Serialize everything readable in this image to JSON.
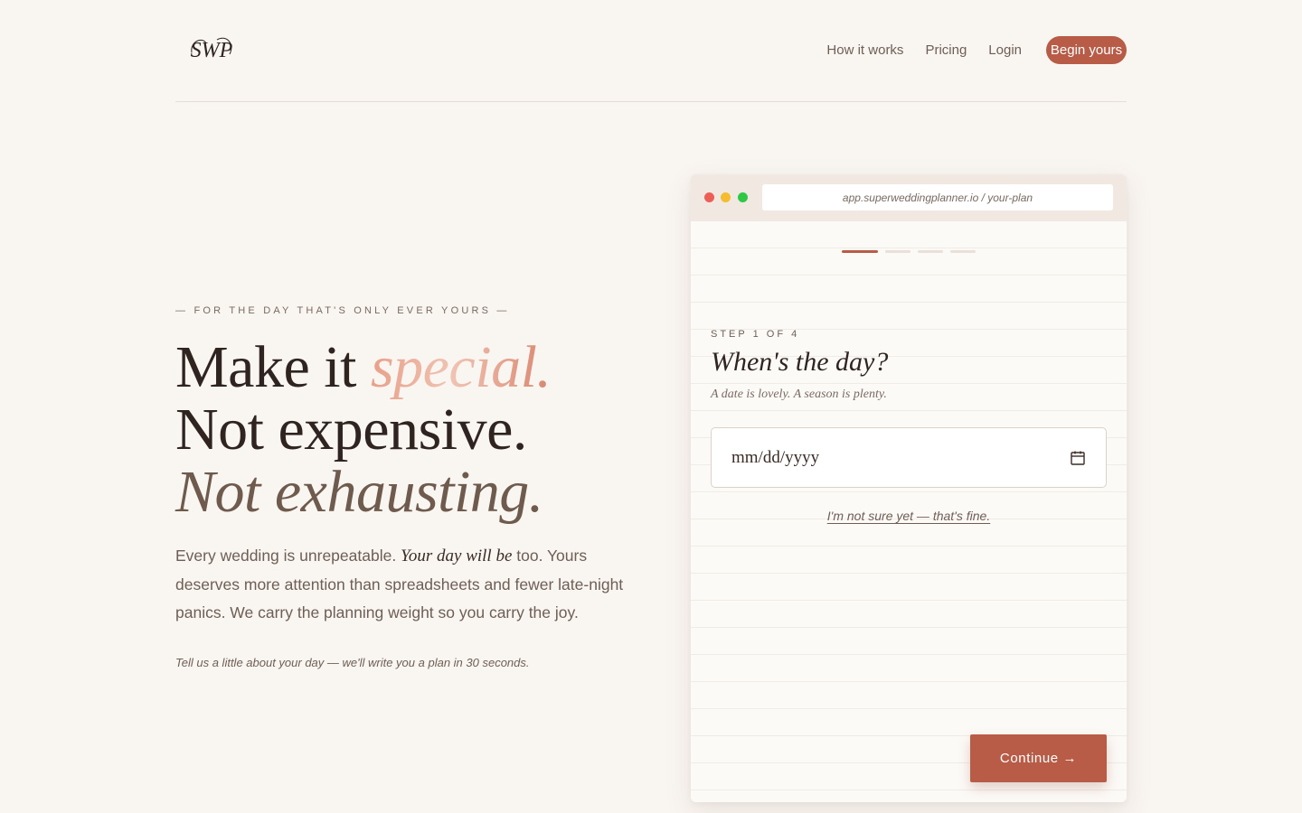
{
  "header": {
    "logo_alt": "SWP",
    "nav": [
      {
        "label": "How it works"
      },
      {
        "label": "Pricing"
      },
      {
        "label": "Login"
      }
    ],
    "cta_label": "Begin yours"
  },
  "hero": {
    "eyebrow": "— FOR THE DAY THAT'S ONLY EVER YOURS —",
    "headline_line1_prefix": "Make it ",
    "headline_line1_accent": "special.",
    "headline_line2": "Not expensive.",
    "headline_line3": "Not exhausting.",
    "lede_part1": "Every wedding is unrepeatable. ",
    "lede_emphasis": "Your day will be",
    "lede_part2": " too. Yours deserves more attention than spreadsheets and fewer late-night panics. We carry the planning weight so you carry the joy.",
    "footnote": "Tell us a little about your day — we'll write you a plan in 30 seconds."
  },
  "browser": {
    "url": "app.superweddingplanner.io / your-plan",
    "progress_steps": 4,
    "progress_active": 1,
    "step_label": "STEP 1 OF 4",
    "step_title": "When's the day?",
    "step_subtitle": "A date is lovely. A season is plenty.",
    "date_placeholder": "mm/dd/yyyy",
    "not_sure_link": "I'm not sure yet — that's fine.",
    "continue_label": "Continue →"
  },
  "colors": {
    "accent": "#b85c48",
    "background": "#f9f5f1",
    "text_dark": "#2f2420",
    "text_muted": "#6e5e55"
  }
}
